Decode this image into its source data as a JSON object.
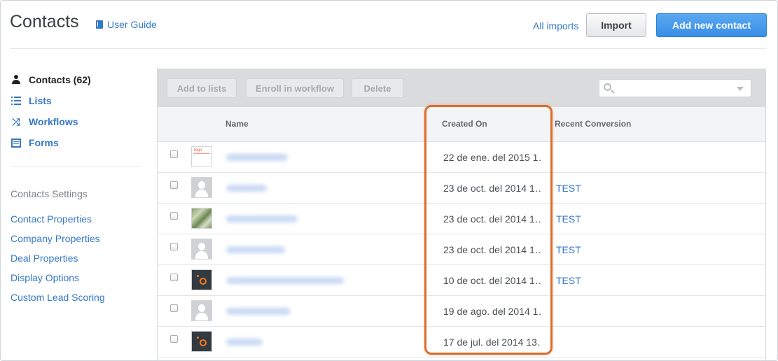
{
  "header": {
    "title": "Contacts",
    "user_guide": "User Guide",
    "all_imports": "All imports",
    "import_label": "Import",
    "add_contact_label": "Add new contact"
  },
  "sidebar": {
    "items": [
      {
        "label": "Contacts (62)",
        "icon": "person-icon",
        "active": true
      },
      {
        "label": "Lists",
        "icon": "list-icon"
      },
      {
        "label": "Workflows",
        "icon": "shuffle-icon"
      },
      {
        "label": "Forms",
        "icon": "form-icon"
      }
    ],
    "settings_heading": "Contacts Settings",
    "settings_links": [
      "Contact Properties",
      "Company Properties",
      "Deal Properties",
      "Display Options",
      "Custom Lead Scoring"
    ]
  },
  "toolbar": {
    "add_to_lists": "Add to lists",
    "enroll": "Enroll in workflow",
    "delete": "Delete",
    "search_placeholder": ""
  },
  "table": {
    "columns": [
      "Name",
      "Created On",
      "Recent Conversion"
    ],
    "rows": [
      {
        "avatar": "logo",
        "created": "22 de ene. del 2015 1…",
        "conversion": ""
      },
      {
        "avatar": "person",
        "created": "23 de oct. del 2014 1…",
        "conversion": "TEST"
      },
      {
        "avatar": "money",
        "created": "23 de oct. del 2014 1…",
        "conversion": "TEST"
      },
      {
        "avatar": "person",
        "created": "23 de oct. del 2014 1…",
        "conversion": "TEST"
      },
      {
        "avatar": "hubspot",
        "created": "10 de oct. del 2014 1…",
        "conversion": "TEST"
      },
      {
        "avatar": "person",
        "created": "19 de ago. del 2014 1…",
        "conversion": ""
      },
      {
        "avatar": "hubspot",
        "created": "17 de jul. del 2014 13…",
        "conversion": ""
      }
    ]
  },
  "colors": {
    "link": "#3578c6",
    "primary_button": "#3a8ee6",
    "highlight": "#e06c28"
  }
}
